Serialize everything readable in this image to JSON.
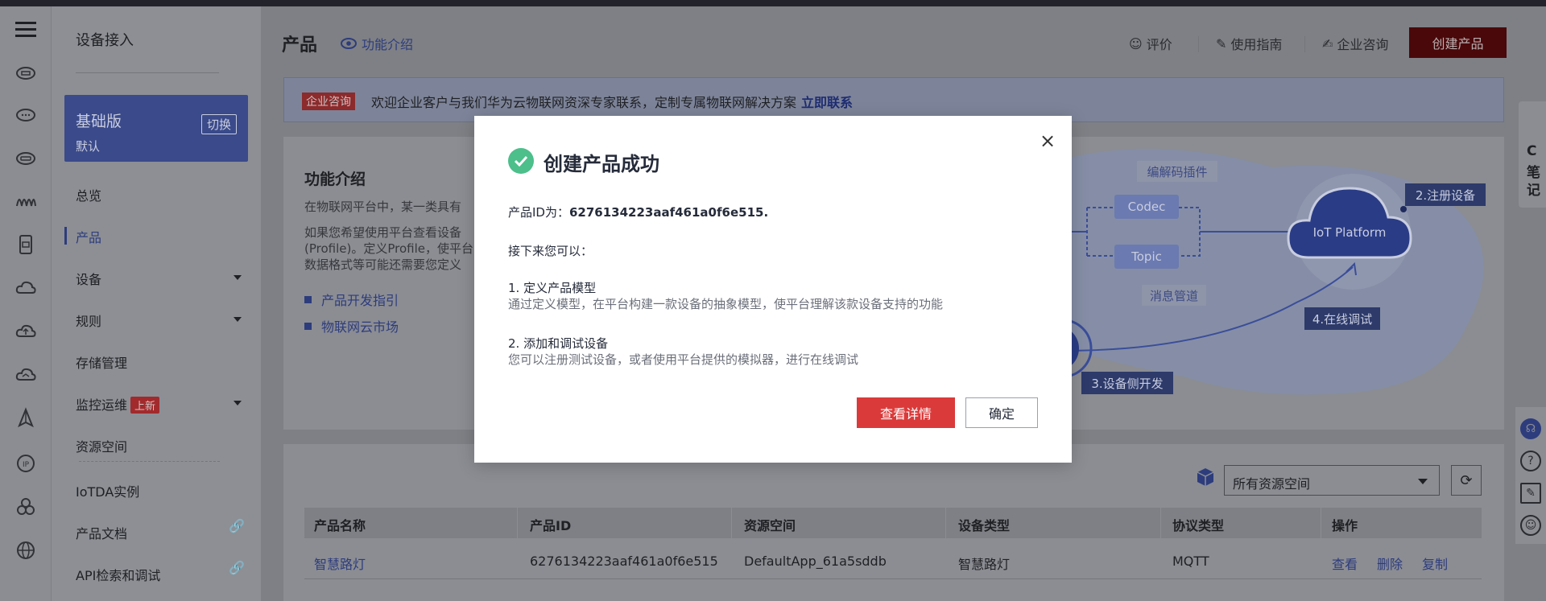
{
  "nav_rail": {
    "icons": [
      "menu-icon",
      "cloud-device-icon",
      "cloud-icon",
      "cloud-box-icon",
      "wave-icon",
      "phone-icon",
      "cloud-icon",
      "cloud-upload-icon",
      "cloud-sync-icon",
      "deploy-icon",
      "ip-icon",
      "cluster-icon",
      "globe-icon"
    ]
  },
  "sidebar": {
    "title": "设备接入",
    "plan": {
      "name": "基础版",
      "sub": "默认",
      "switch_label": "切换"
    },
    "items": [
      {
        "label": "总览"
      },
      {
        "label": "产品"
      },
      {
        "label": "设备"
      },
      {
        "label": "规则"
      },
      {
        "label": "存储管理"
      },
      {
        "label": "监控运维",
        "badge": "上新"
      },
      {
        "label": "资源空间"
      },
      {
        "label": "IoTDA实例"
      },
      {
        "label": "产品文档"
      },
      {
        "label": "API检索和调试"
      }
    ]
  },
  "header": {
    "title": "产品",
    "intro_link": "功能介绍",
    "actions": [
      "评价",
      "使用指南",
      "企业咨询"
    ],
    "create_button": "创建产品"
  },
  "banner": {
    "tag": "企业咨询",
    "message": "欢迎企业客户与我们华为云物联网资深专家联系，定制专属物联网解决方案",
    "link": "立即联系"
  },
  "intro_card": {
    "heading": "功能介绍",
    "lines": [
      "在物联网平台中，某一类具有",
      "如果您希望使用平台查看设备",
      "(Profile)。定义Profile，使平台",
      "数据格式等可能还需要您定义"
    ],
    "links": [
      "产品开发指引",
      "物联网云市场"
    ],
    "diagram": {
      "codec_plugin": "编解码插件",
      "codec": "Codec",
      "topic": "Topic",
      "msg_pipe": "消息管道",
      "platform": "IoT Platform",
      "step2": "2.注册设备",
      "step3": "3.设备侧开发",
      "step4": "4.在线调试"
    }
  },
  "table": {
    "resource_select": "所有资源空间",
    "columns": [
      "产品名称",
      "产品ID",
      "资源空间",
      "设备类型",
      "协议类型",
      "操作"
    ],
    "rows": [
      {
        "name": "智慧路灯",
        "id": "6276134223aaf461a0f6e515",
        "space": "DefaultApp_61a5sddb",
        "type": "智慧路灯",
        "protocol": "MQTT",
        "ops": [
          "查看",
          "删除",
          "复制"
        ]
      }
    ]
  },
  "note_tab": [
    "C",
    "笔",
    "记"
  ],
  "modal": {
    "title": "创建产品成功",
    "pid_label": "产品ID为：",
    "pid_value": "6276134223aaf461a0f6e515.",
    "next": "接下来您可以：",
    "step1_title": "1. 定义产品模型",
    "step1_desc": "通过定义模型，在平台构建一款设备的抽象模型，使平台理解该款设备支持的功能",
    "step2_title": "2. 添加和调试设备",
    "step2_desc": "您可以注册测试设备，或者使用平台提供的模拟器，进行在线调试",
    "detail_button": "查看详情",
    "ok_button": "确定"
  },
  "colors": {
    "accent_red": "#db3a3a",
    "success": "#4cbf8b",
    "link_blue": "#526ecc"
  }
}
